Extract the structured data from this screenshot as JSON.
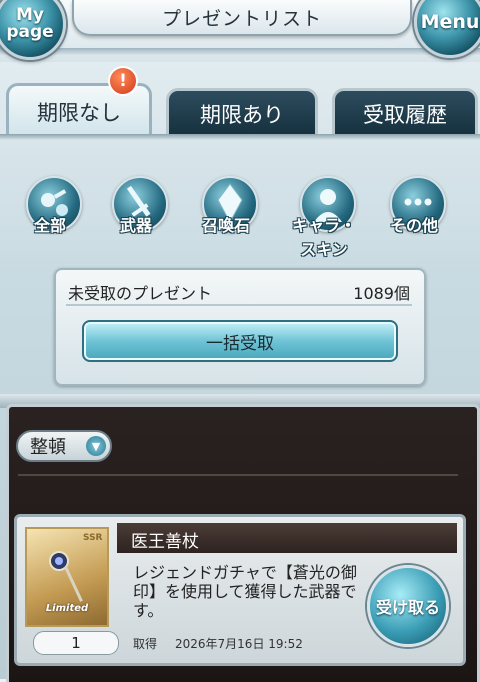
{
  "header": {
    "title": "プレゼントリスト",
    "mypage_label": "My page",
    "menu_label": "Menu"
  },
  "tabs": [
    {
      "label": "期限なし",
      "active": true
    },
    {
      "label": "期限あり",
      "active": false
    },
    {
      "label": "受取履歴",
      "active": false
    }
  ],
  "alert_badge": "!",
  "filters": [
    {
      "label": "全部",
      "icon": "all-items-icon"
    },
    {
      "label": "武器",
      "icon": "sword-icon"
    },
    {
      "label": "召喚石",
      "icon": "crystal-icon"
    },
    {
      "label": "キャラ・スキン",
      "icon": "character-silhouette-icon"
    },
    {
      "label": "その他",
      "icon": "more-dots-icon"
    }
  ],
  "summary": {
    "label": "未受取のプレゼント",
    "count": "1089個",
    "receive_all_label": "一括受取"
  },
  "sort": {
    "label": "整頓"
  },
  "item": {
    "name": "医王善杖",
    "description": "レジェンドガチャで【蒼光の御印】を使用して獲得した武器です。",
    "receive_label": "受け取る",
    "quantity": "1",
    "acquired_label": "取得",
    "acquired_date": "2026年7月16日 19:52",
    "thumb_tag": "Limited",
    "rarity_tag": "SSR"
  },
  "colors": {
    "accent": "#3d94a9",
    "dark_panel": "#2a2220",
    "alert": "#d03a1a"
  }
}
